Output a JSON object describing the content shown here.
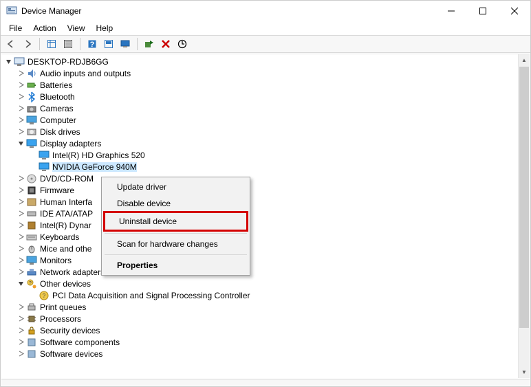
{
  "window": {
    "title": "Device Manager"
  },
  "menu": {
    "file": "File",
    "action": "Action",
    "view": "View",
    "help": "Help"
  },
  "tree": {
    "root": "DESKTOP-RDJB6GG",
    "audio": "Audio inputs and outputs",
    "batteries": "Batteries",
    "bluetooth": "Bluetooth",
    "cameras": "Cameras",
    "computer": "Computer",
    "disk": "Disk drives",
    "display": "Display adapters",
    "display_children": {
      "intel": "Intel(R) HD Graphics 520",
      "nvidia": "NVIDIA GeForce 940M"
    },
    "dvd": "DVD/CD-ROM",
    "firmware": "Firmware",
    "hid": "Human Interfa",
    "ide": "IDE ATA/ATAP",
    "idt": "Intel(R) Dynar",
    "keyboards": "Keyboards",
    "mice": "Mice and othe",
    "monitors": "Monitors",
    "network": "Network adapters",
    "other": "Other devices",
    "other_children": {
      "pci": "PCI Data Acquisition and Signal Processing Controller"
    },
    "printq": "Print queues",
    "processors": "Processors",
    "security": "Security devices",
    "softcomp": "Software components",
    "softdev": "Software devices"
  },
  "context_menu": {
    "update": "Update driver",
    "disable": "Disable device",
    "uninstall": "Uninstall device",
    "scan": "Scan for hardware changes",
    "properties": "Properties"
  },
  "icons": {
    "back": "back-icon",
    "forward": "forward-icon",
    "showhide": "showhide-icon",
    "properties": "properties-icon",
    "help": "help-icon",
    "scan": "scan-icon",
    "monitor": "monitor-icon",
    "enable": "enable-icon",
    "delete": "delete-icon",
    "update": "update-icon"
  }
}
